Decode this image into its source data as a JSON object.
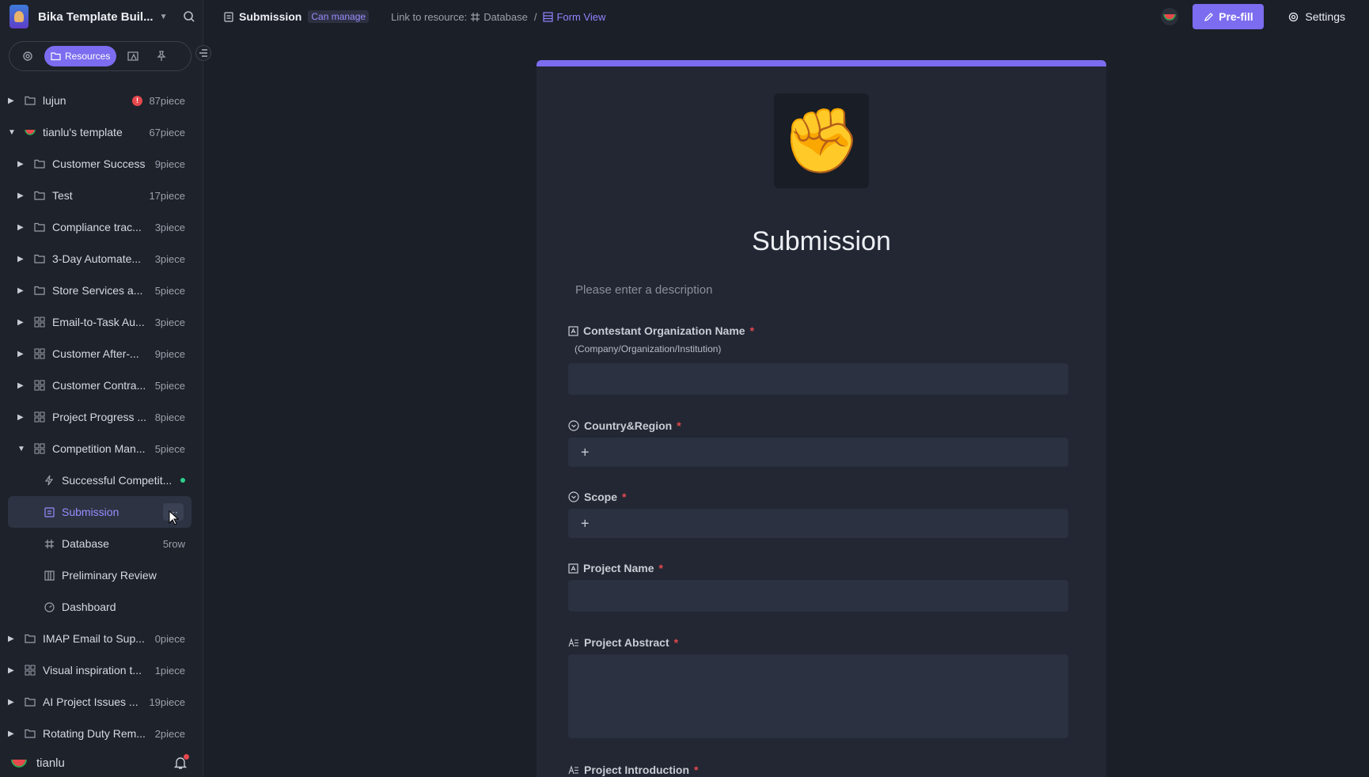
{
  "workspace": {
    "title": "Bika Template Buil..."
  },
  "sidebar": {
    "tabs": {
      "active_label": "Resources"
    },
    "items": [
      {
        "label": "lujun",
        "count": "87piece",
        "badge": "!"
      },
      {
        "label": "tianlu's template",
        "count": "67piece"
      },
      {
        "label": "Customer Success",
        "count": "9piece"
      },
      {
        "label": "Test",
        "count": "17piece"
      },
      {
        "label": "Compliance trac...",
        "count": "3piece"
      },
      {
        "label": "3-Day Automate...",
        "count": "3piece"
      },
      {
        "label": "Store Services a...",
        "count": "5piece"
      },
      {
        "label": "Email-to-Task Au...",
        "count": "3piece"
      },
      {
        "label": "Customer After-...",
        "count": "9piece"
      },
      {
        "label": "Customer Contra...",
        "count": "5piece"
      },
      {
        "label": "Project Progress ...",
        "count": "8piece"
      },
      {
        "label": "Competition Man...",
        "count": "5piece"
      },
      {
        "label": "Successful Competit..."
      },
      {
        "label": "Submission",
        "more": "···"
      },
      {
        "label": "Database",
        "count": "5row"
      },
      {
        "label": "Preliminary Review"
      },
      {
        "label": "Dashboard"
      },
      {
        "label": "IMAP Email to Sup...",
        "count": "0piece"
      },
      {
        "label": "Visual inspiration t...",
        "count": "1piece"
      },
      {
        "label": "AI Project Issues ...",
        "count": "19piece"
      },
      {
        "label": "Rotating Duty Rem...",
        "count": "2piece"
      }
    ],
    "user": {
      "name": "tianlu"
    }
  },
  "topbar": {
    "title": "Submission",
    "permission": "Can manage",
    "link_prefix": "Link to resource:",
    "link_database": "Database",
    "link_separator": "/",
    "link_view": "Form View",
    "prefill_label": "Pre-fill",
    "settings_label": "Settings"
  },
  "form": {
    "icon": "✊",
    "title": "Submission",
    "description_placeholder": "Please enter a description",
    "fields": [
      {
        "label": "Contestant Organization Name",
        "required": "*",
        "hint": "(Company/Organization/Institution)"
      },
      {
        "label": "Country&Region",
        "required": "*",
        "add": "+"
      },
      {
        "label": "Scope",
        "required": "*",
        "add": "+"
      },
      {
        "label": "Project Name",
        "required": "*"
      },
      {
        "label": "Project Abstract",
        "required": "*"
      },
      {
        "label": "Project Introduction",
        "required": "*"
      }
    ]
  },
  "colors": {
    "accent": "#7b6cf0",
    "required": "#e5484d",
    "background": "#1b1f28"
  }
}
